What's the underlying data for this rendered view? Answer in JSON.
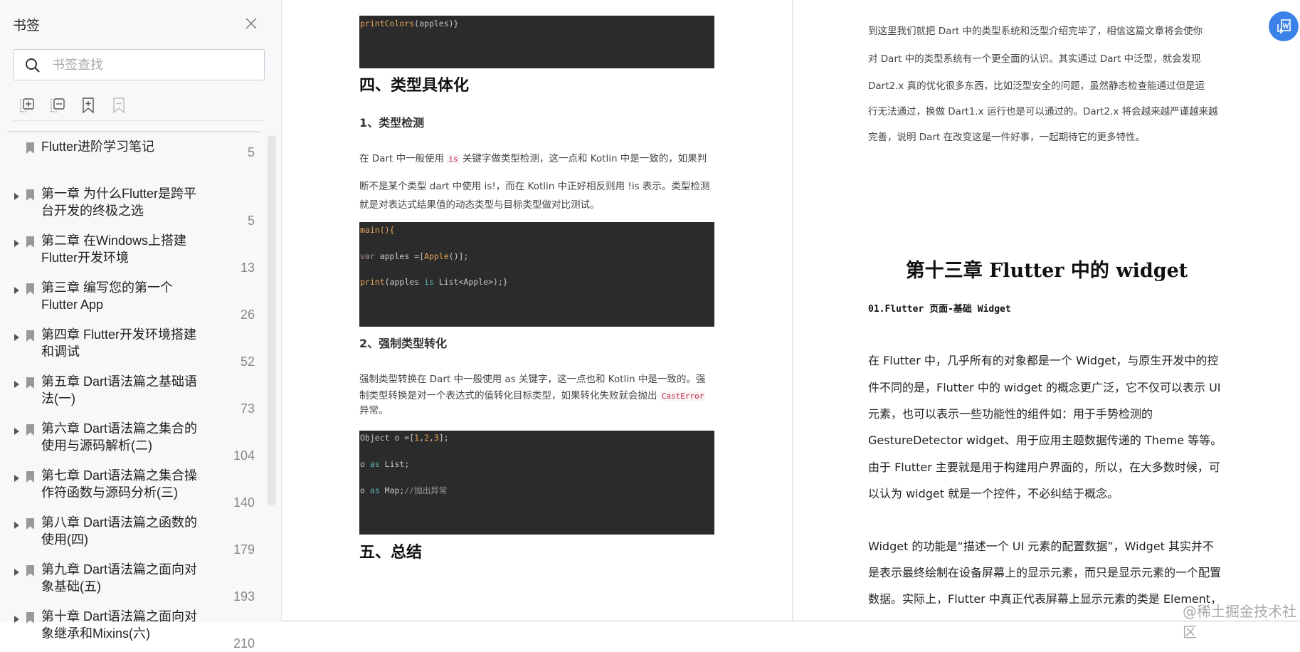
{
  "sidebar": {
    "title": "书签",
    "search_placeholder": "书签查找",
    "tools": [
      "expand-all-icon",
      "collapse-all-icon",
      "add-bookmark-icon",
      "remove-bookmark-icon"
    ],
    "items": [
      {
        "label": "Flutter进阶学习笔记",
        "page": "5",
        "expandable": false
      },
      {
        "label": "第一章 为什么Flutter是跨平台开发的终极之选",
        "page": "5",
        "expandable": true
      },
      {
        "label": "第二章 在Windows上搭建Flutter开发环境",
        "page": "13",
        "expandable": true
      },
      {
        "label": "第三章 编写您的第一个 Flutter App",
        "page": "26",
        "expandable": true
      },
      {
        "label": "第四章 Flutter开发环境搭建和调试",
        "page": "52",
        "expandable": true
      },
      {
        "label": "第五章 Dart语法篇之基础语法(一)",
        "page": "73",
        "expandable": true
      },
      {
        "label": "第六章 Dart语法篇之集合的使用与源码解析(二)",
        "page": "104",
        "expandable": true
      },
      {
        "label": "第七章 Dart语法篇之集合操作符函数与源码分析(三)",
        "page": "140",
        "expandable": true
      },
      {
        "label": "第八章 Dart语法篇之函数的使用(四)",
        "page": "179",
        "expandable": true
      },
      {
        "label": "第九章 Dart语法篇之面向对象基础(五)",
        "page": "193",
        "expandable": true
      },
      {
        "label": "第十章 Dart语法篇之面向对象继承和Mixins(六)",
        "page": "210",
        "expandable": true
      }
    ]
  },
  "left_page": {
    "code1": {
      "fn": "printColors",
      "rest": "(apples)}"
    },
    "h_four": "四、类型具体化",
    "h_1": "1、类型检测",
    "p1": {
      "a": "在 Dart 中一般使用 ",
      "code": "is",
      "b": " 关键字做类型检测，这一点和 Kotlin 中是一致的，如果判",
      "line2": "断不是某个类型 dart 中使用 is!，而在 Kotlin 中正好相反则用 !is 表示。类型检测",
      "line3": "就是对表达式结果值的动态类型与目标类型做对比测试。"
    },
    "code2": {
      "l1": "main(){",
      "l2a": "var",
      "l2b": " apples =[",
      "l2c": "Apple",
      "l2d": "()];",
      "l3a": "print",
      "l3b": "(apples ",
      "l3c": "is",
      "l3d": " List<Apple>);}"
    },
    "h_2": "2、强制类型转化",
    "p2": {
      "line1": "强制类型转换在 Dart 中一般使用 as 关键字，这一点也和 Kotlin 中是一致的。强",
      "line2": "制类型转换是对一个表达式的值转化目标类型，如果转化失败就会抛出 ",
      "code": "CastError",
      "line3": "异常。"
    },
    "code3": {
      "l1a": "Object o =[",
      "l1b": "1",
      "l1c": ",",
      "l1d": "2",
      "l1e": ",",
      "l1f": "3",
      "l1g": "];",
      "l2a": "o ",
      "l2b": "as",
      "l2c": " List;",
      "l3a": "o ",
      "l3b": "as",
      "l3c": " Map;",
      "l3d": "//抛出异常"
    },
    "h_five": "五、总结"
  },
  "right_page": {
    "summary": [
      "到这里我们就把 Dart 中的类型系统和泛型介绍完毕了，相信这篇文章将会使你",
      "对 Dart 中的类型系统有一个更全面的认识。其实通过 Dart 中泛型，就会发现",
      "Dart2.x 真的优化很多东西，比如泛型安全的问题，虽然静态检查能通过但是运",
      "行无法通过，换做 Dart1.x 运行也是可以通过的。Dart2.x 将会越来越严谨越来越",
      "完善，说明 Dart 在改变这是一件好事，一起期待它的更多特性。"
    ],
    "chapter_title": "第十三章 Flutter 中的 widget",
    "section_title": "01.Flutter 页面-基础 Widget",
    "para1": [
      "在 Flutter 中，几乎所有的对象都是一个  Widget，与原生开发中的控",
      "件不同的是，Flutter 中的  widget 的概念更广泛，它不仅可以表示 UI",
      "元素，也可以表示一些功能性的组件如：用于手势检测的",
      "GestureDetector widget、用于应用主题数据传递的  Theme 等等。",
      "由于 Flutter 主要就是用于构建用户界面的，所以，在大多数时候，可",
      "以认为 widget 就是一个控件，不必纠结于概念。"
    ],
    "para2": [
      "Widget 的功能是“描述一个 UI 元素的配置数据”，Widget 其实并不",
      "是表示最终绘制在设备屏幕上的显示元素，而只是显示元素的一个配置",
      "数据。实际上，Flutter 中真正代表屏幕上显示元素的类是  Element，"
    ]
  },
  "fab_icon": "translate-page-icon",
  "watermark": "@稀土掘金技术社区",
  "colors": {
    "accent": "#3b82e8",
    "code_bg": "#2b2b2b",
    "sidebar_bg": "#f7f8fa"
  }
}
